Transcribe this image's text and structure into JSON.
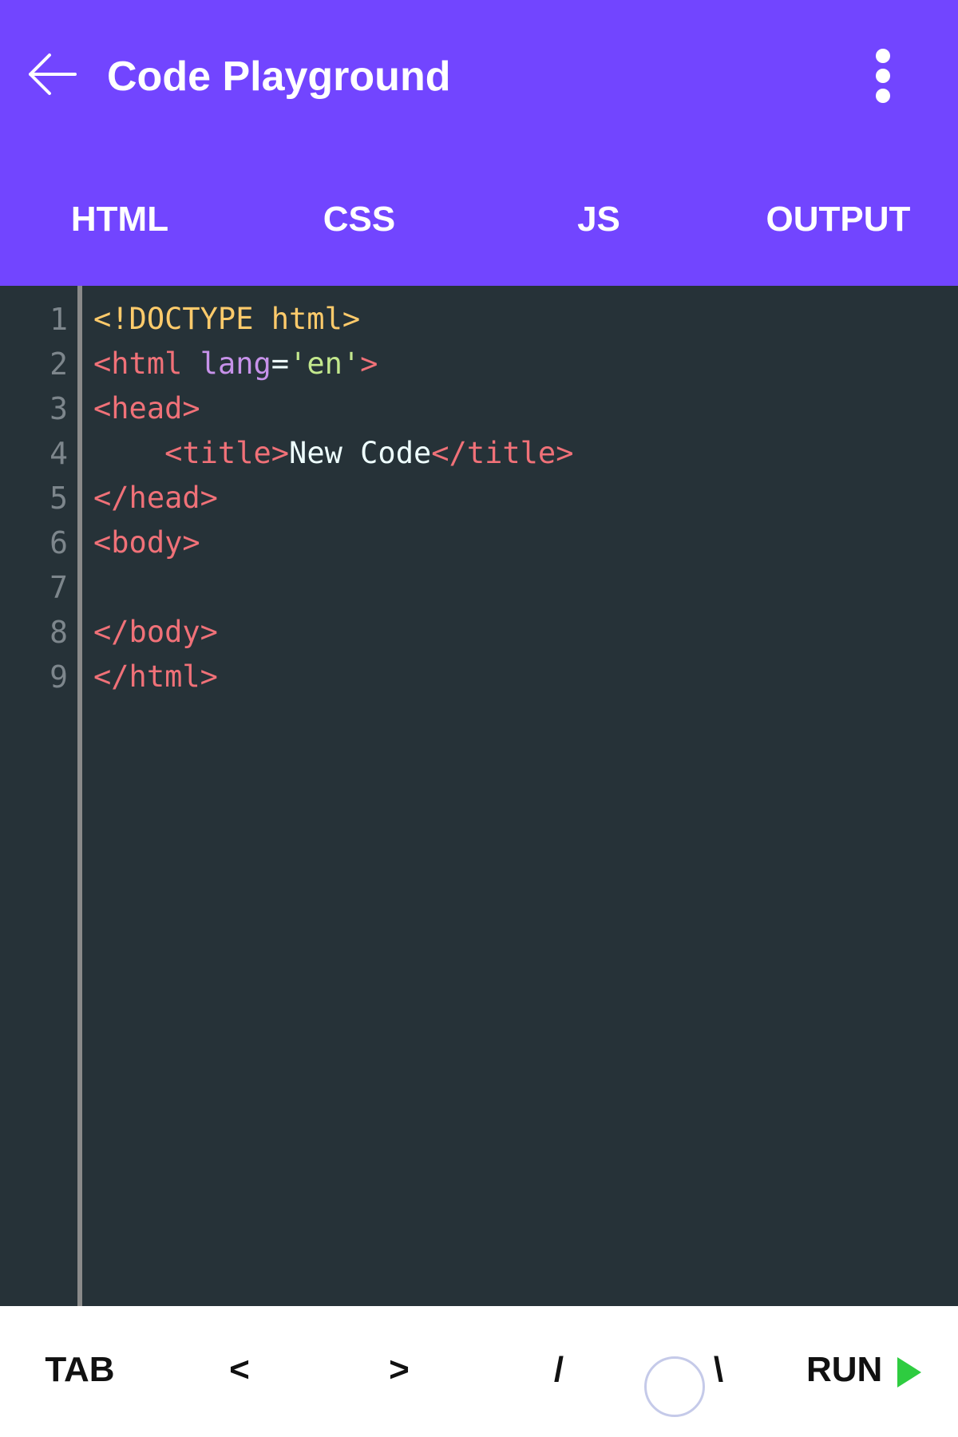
{
  "header": {
    "title": "Code Playground",
    "back_icon": "arrow-left-icon",
    "menu_icon": "more-vert-icon",
    "background_color": "#7245ff"
  },
  "tabs": [
    {
      "label": "HTML"
    },
    {
      "label": "CSS"
    },
    {
      "label": "JS"
    },
    {
      "label": "OUTPUT"
    }
  ],
  "editor": {
    "background_color": "#263238",
    "line_numbers": [
      "1",
      "2",
      "3",
      "4",
      "5",
      "6",
      "7",
      "8",
      "9"
    ],
    "lines": [
      [
        {
          "t": "<!DOCTYPE html>",
          "c": "#ffcb6b"
        }
      ],
      [
        {
          "t": "<html",
          "c": "#f07178"
        },
        {
          "t": " ",
          "c": "#eeffff"
        },
        {
          "t": "lang",
          "c": "#c792ea"
        },
        {
          "t": "=",
          "c": "#eeffff"
        },
        {
          "t": "'en'",
          "c": "#c3e88d"
        },
        {
          "t": ">",
          "c": "#f07178"
        }
      ],
      [
        {
          "t": "<head>",
          "c": "#f07178"
        }
      ],
      [
        {
          "t": "    ",
          "c": "#eeffff"
        },
        {
          "t": "<title>",
          "c": "#f07178"
        },
        {
          "t": "New Code",
          "c": "#eeffff"
        },
        {
          "t": "</title>",
          "c": "#f07178"
        }
      ],
      [
        {
          "t": "</head>",
          "c": "#f07178"
        }
      ],
      [
        {
          "t": "<body>",
          "c": "#f07178"
        }
      ],
      [],
      [
        {
          "t": "</body>",
          "c": "#f07178"
        }
      ],
      [
        {
          "t": "</html>",
          "c": "#f07178"
        }
      ]
    ]
  },
  "keybar": {
    "keys": [
      "TAB",
      "<",
      ">",
      "/",
      "\\"
    ],
    "run_label": "RUN",
    "run_icon": "play-icon",
    "run_icon_color": "#2ecc40"
  }
}
